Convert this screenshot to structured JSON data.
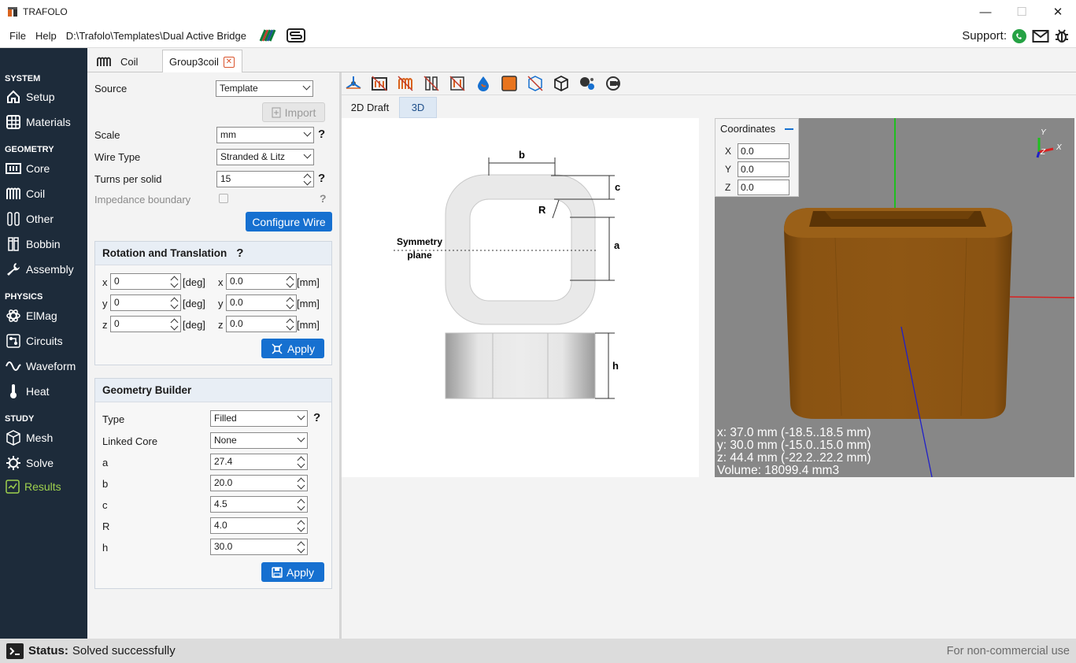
{
  "window": {
    "title": "TRAFOLO",
    "minimize": "—",
    "maximize": "☐",
    "close": "✕"
  },
  "menu": {
    "file": "File",
    "help": "Help",
    "path": "D:\\Trafolo\\Templates\\Dual Active Bridge",
    "support": "Support:"
  },
  "sidebar": {
    "system": "SYSTEM",
    "setup": "Setup",
    "materials": "Materials",
    "geometry": "GEOMETRY",
    "core": "Core",
    "coil": "Coil",
    "other": "Other",
    "bobbin": "Bobbin",
    "assembly": "Assembly",
    "physics": "PHYSICS",
    "elmag": "ElMag",
    "circuits": "Circuits",
    "waveform": "Waveform",
    "heat": "Heat",
    "study": "STUDY",
    "mesh": "Mesh",
    "solve": "Solve",
    "results": "Results"
  },
  "tabs": {
    "coil": "Coil",
    "group": "Group3coil"
  },
  "form": {
    "source_label": "Source",
    "source_value": "Template",
    "import_label": "Import",
    "scale_label": "Scale",
    "scale_value": "mm",
    "wiretype_label": "Wire Type",
    "wiretype_value": "Stranded & Litz",
    "turns_label": "Turns per solid",
    "turns_value": "15",
    "impedance_label": "Impedance boundary",
    "configure_wire": "Configure Wire",
    "q": "?"
  },
  "rotation": {
    "title": "Rotation and Translation",
    "x_label": "x",
    "y_label": "y",
    "z_label": "z",
    "rx": "0",
    "ry": "0",
    "rz": "0",
    "tx": "0.0",
    "ty": "0.0",
    "tz": "0.0",
    "deg": "[deg]",
    "mm": "[mm]",
    "apply": "Apply"
  },
  "builder": {
    "title": "Geometry Builder",
    "type_label": "Type",
    "type_value": "Filled",
    "linked_label": "Linked Core",
    "linked_value": "None",
    "a_label": "a",
    "a_value": "27.4",
    "b_label": "b",
    "b_value": "20.0",
    "c_label": "c",
    "c_value": "4.5",
    "r_label": "R",
    "r_value": "4.0",
    "h_label": "h",
    "h_value": "30.0",
    "apply": "Apply"
  },
  "viewtabs": {
    "draft": "2D Draft",
    "view3d": "3D"
  },
  "draft": {
    "b": "b",
    "c": "c",
    "r": "R",
    "a": "a",
    "h": "h",
    "sym1": "Symmetry",
    "sym2": "plane"
  },
  "coords": {
    "title": "Coordinates",
    "x_label": "X",
    "y_label": "Y",
    "z_label": "Z",
    "x": "0.0",
    "y": "0.0",
    "z": "0.0"
  },
  "axes": {
    "y": "Y",
    "x": "X",
    "z": "Z"
  },
  "info3d": {
    "x": "x: 37.0 mm (-18.5..18.5 mm)",
    "y": "y: 30.0 mm (-15.0..15.0 mm)",
    "z": "z: 44.4 mm (-22.2..22.2 mm)",
    "volume": "Volume: 18099.4 mm3"
  },
  "status": {
    "label": "Status:",
    "message": "Solved successfully",
    "license": "For non-commercial use"
  }
}
